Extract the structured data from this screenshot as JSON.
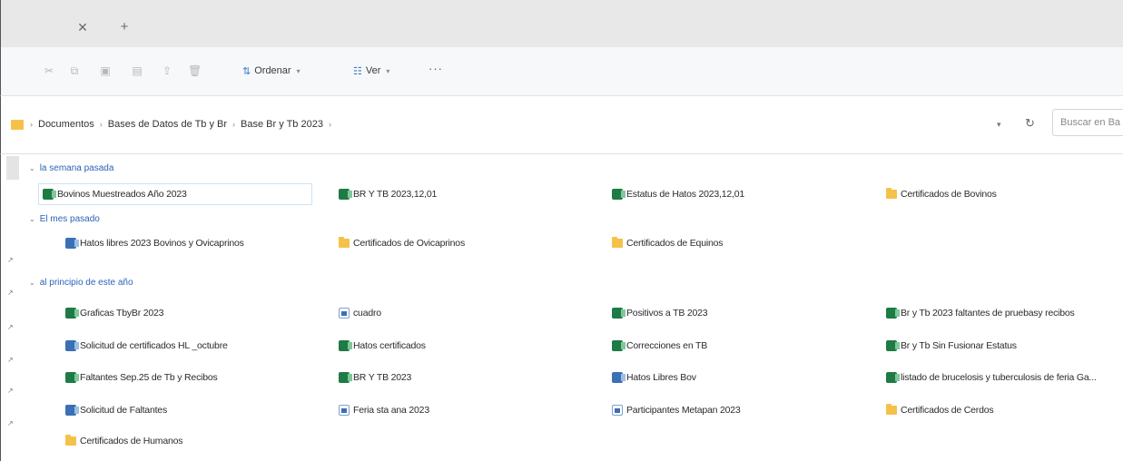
{
  "toolbar": {
    "sort_label": "Ordenar",
    "view_label": "Ver",
    "more_label": "···"
  },
  "address": {
    "crumbs": [
      "Documentos",
      "Bases de Datos de Tb y Br",
      "Base Br y Tb 2023"
    ],
    "search_placeholder": "Buscar en Ba"
  },
  "groups": [
    {
      "label": "la semana pasada",
      "items": [
        {
          "name": "Bovinos Muestreados Año 2023",
          "icon": "excel"
        },
        {
          "name": "BR Y TB 2023,12,01",
          "icon": "excel"
        },
        {
          "name": "Estatus de Hatos 2023,12,01",
          "icon": "excel"
        },
        {
          "name": "Certificados de Bovinos",
          "icon": "folder"
        }
      ]
    },
    {
      "label": "El mes pasado",
      "items": [
        {
          "name": "Hatos libres 2023 Bovinos y Ovicaprinos",
          "icon": "excel-blue"
        },
        {
          "name": "Certificados de Ovicaprinos",
          "icon": "folder"
        },
        {
          "name": "Certificados de Equinos",
          "icon": "folder"
        }
      ]
    },
    {
      "label": "al principio de este año",
      "items": [
        {
          "name": "Graficas TbyBr 2023",
          "icon": "excel"
        },
        {
          "name": "cuadro",
          "icon": "word"
        },
        {
          "name": "Positivos a TB 2023",
          "icon": "excel"
        },
        {
          "name": "Br y Tb 2023 faltantes de pruebasy recibos",
          "icon": "excel"
        },
        {
          "name": "Solicitud de certificados HL _octubre",
          "icon": "excel-blue"
        },
        {
          "name": "Hatos certificados",
          "icon": "excel"
        },
        {
          "name": "Correcciones en TB",
          "icon": "excel"
        },
        {
          "name": "Br y Tb Sin Fusionar Estatus",
          "icon": "excel"
        },
        {
          "name": "Faltantes Sep.25 de Tb y Recibos",
          "icon": "excel"
        },
        {
          "name": "BR Y TB 2023",
          "icon": "excel"
        },
        {
          "name": "Hatos Libres Bov",
          "icon": "excel-blue"
        },
        {
          "name": "listado de brucelosis y tuberculosis de feria Ga...",
          "icon": "excel"
        },
        {
          "name": "Solicitud de Faltantes",
          "icon": "excel-blue"
        },
        {
          "name": "Feria sta ana 2023",
          "icon": "word"
        },
        {
          "name": "Participantes Metapan 2023",
          "icon": "word"
        },
        {
          "name": "Certificados de Cerdos",
          "icon": "folder"
        },
        {
          "name": "Certificados de Humanos",
          "icon": "folder"
        }
      ]
    }
  ]
}
